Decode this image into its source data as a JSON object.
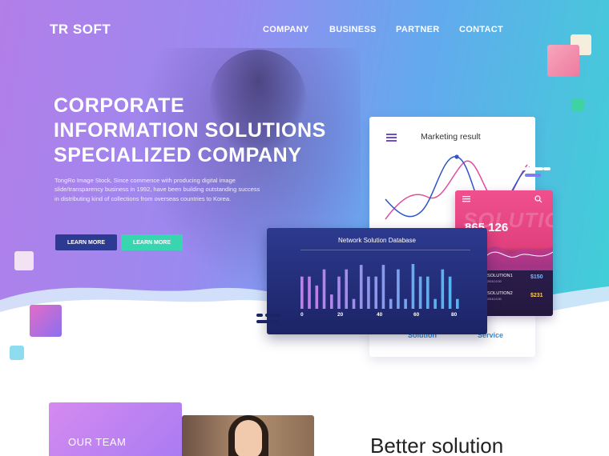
{
  "brand": "TR SOFT",
  "nav": [
    "COMPANY",
    "BUSINESS",
    "PARTNER",
    "CONTACT"
  ],
  "hero": {
    "headline": [
      "CORPORATE",
      "INFORMATION SOLUTIONS",
      "SPECIALIZED COMPANY"
    ],
    "description": [
      "TongRo Image Stock, Since commence with producing digital image",
      "slide/transparency business in 1992, have been building outstanding success",
      "in distributing kind of collections from overseas countries to Korea."
    ],
    "buttons": [
      "LEARN MORE",
      "LEARN MORE"
    ]
  },
  "marketing_card": {
    "title": "Marketing result",
    "footer": [
      "Solution",
      "Service"
    ]
  },
  "pink_card": {
    "watermark": "SOLUTIO",
    "number": "865,126",
    "rows": [
      {
        "label": "SOLUTION1",
        "date": "2018.10.30",
        "price": "$150"
      },
      {
        "label": "SOLUTION2",
        "date": "2018.10.30",
        "price": "$231"
      }
    ]
  },
  "navy_card": {
    "title": "Network Solution Database",
    "ticks": [
      "0",
      "20",
      "40",
      "60",
      "80"
    ]
  },
  "chart_data": {
    "type": "bar",
    "title": "Network Solution Database",
    "x_ticks": [
      0,
      20,
      40,
      60,
      80
    ],
    "values": [
      0.72,
      0.72,
      0.52,
      0.88,
      0.32,
      0.72,
      0.88,
      0.22,
      0.98,
      0.72,
      0.72,
      0.98,
      0.22,
      0.88,
      0.22,
      1.0,
      0.72,
      0.72,
      0.22,
      0.88,
      0.72,
      0.22
    ],
    "ylim": [
      0,
      1
    ]
  },
  "colors": {
    "hero_start": "#b27ee8",
    "hero_end": "#3fd0d6",
    "btn_primary": "#2c3a94",
    "btn_secondary": "#38d6b0",
    "pink": "#f0508e",
    "navy": "#2c3a8f"
  },
  "bottom": {
    "team_label": "OUR TEAM",
    "heading": "Better solution"
  }
}
